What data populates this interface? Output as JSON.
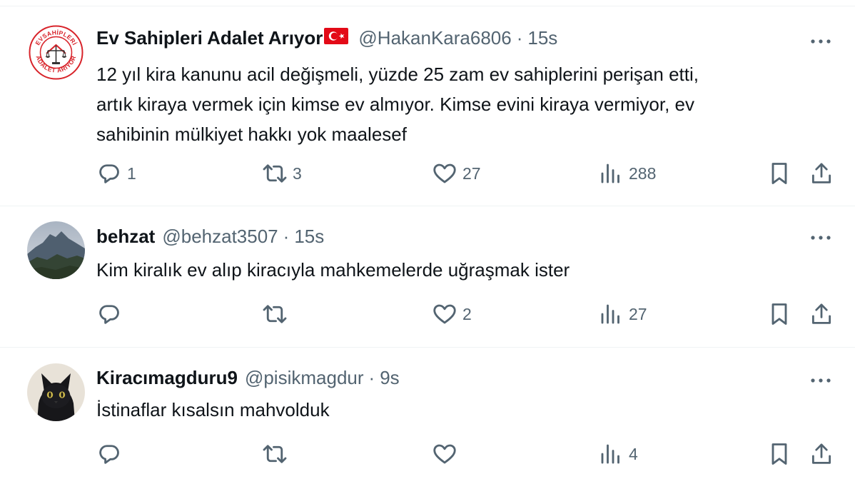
{
  "tweets": [
    {
      "name": "Ev Sahipleri Adalet Arıyor",
      "has_flag": true,
      "handle": "@HakanKara6806",
      "separator": "·",
      "time": "15s",
      "avatar": {
        "kind": "logo",
        "ring_text_top": "EVSAHİPLERİ",
        "ring_text_bottom": "ADALET ARIYOR"
      },
      "text_lines": [
        "12 yıl kira kanunu acil değişmeli, yüzde 25 zam ev sahiplerini perişan etti,",
        "artık kiraya vermek için kimse ev almıyor. Kimse evini kiraya vermiyor, ev",
        "sahibinin mülkiyet hakkı yok maalesef"
      ],
      "replies": "1",
      "retweets": "3",
      "likes": "27",
      "views": "288"
    },
    {
      "name": "behzat",
      "has_flag": false,
      "handle": "@behzat3507",
      "separator": "·",
      "time": "15s",
      "avatar": {
        "kind": "mountain"
      },
      "text_lines": [
        "Kim kiralık ev alıp kiracıyla mahkemelerde uğraşmak ister"
      ],
      "replies": "",
      "retweets": "",
      "likes": "2",
      "views": "27"
    },
    {
      "name": "Kiracımagduru9",
      "has_flag": false,
      "handle": "@pisikmagdur",
      "separator": "·",
      "time": "9s",
      "avatar": {
        "kind": "cat"
      },
      "text_lines": [
        "İstinaflar kısalsın mahvolduk"
      ],
      "replies": "",
      "retweets": "",
      "likes": "",
      "views": "4"
    }
  ],
  "icons": {
    "reply": "reply-icon",
    "retweet": "retweet-icon",
    "like": "heart-icon",
    "views": "views-icon",
    "bookmark": "bookmark-icon",
    "share": "share-icon",
    "more": "more-icon",
    "flag": "turkey-flag-icon"
  },
  "colors": {
    "text": "#0f1419",
    "secondary": "#536471",
    "divider": "#eff3f4",
    "flag_red": "#e30a17",
    "logo_red": "#d8232a"
  }
}
